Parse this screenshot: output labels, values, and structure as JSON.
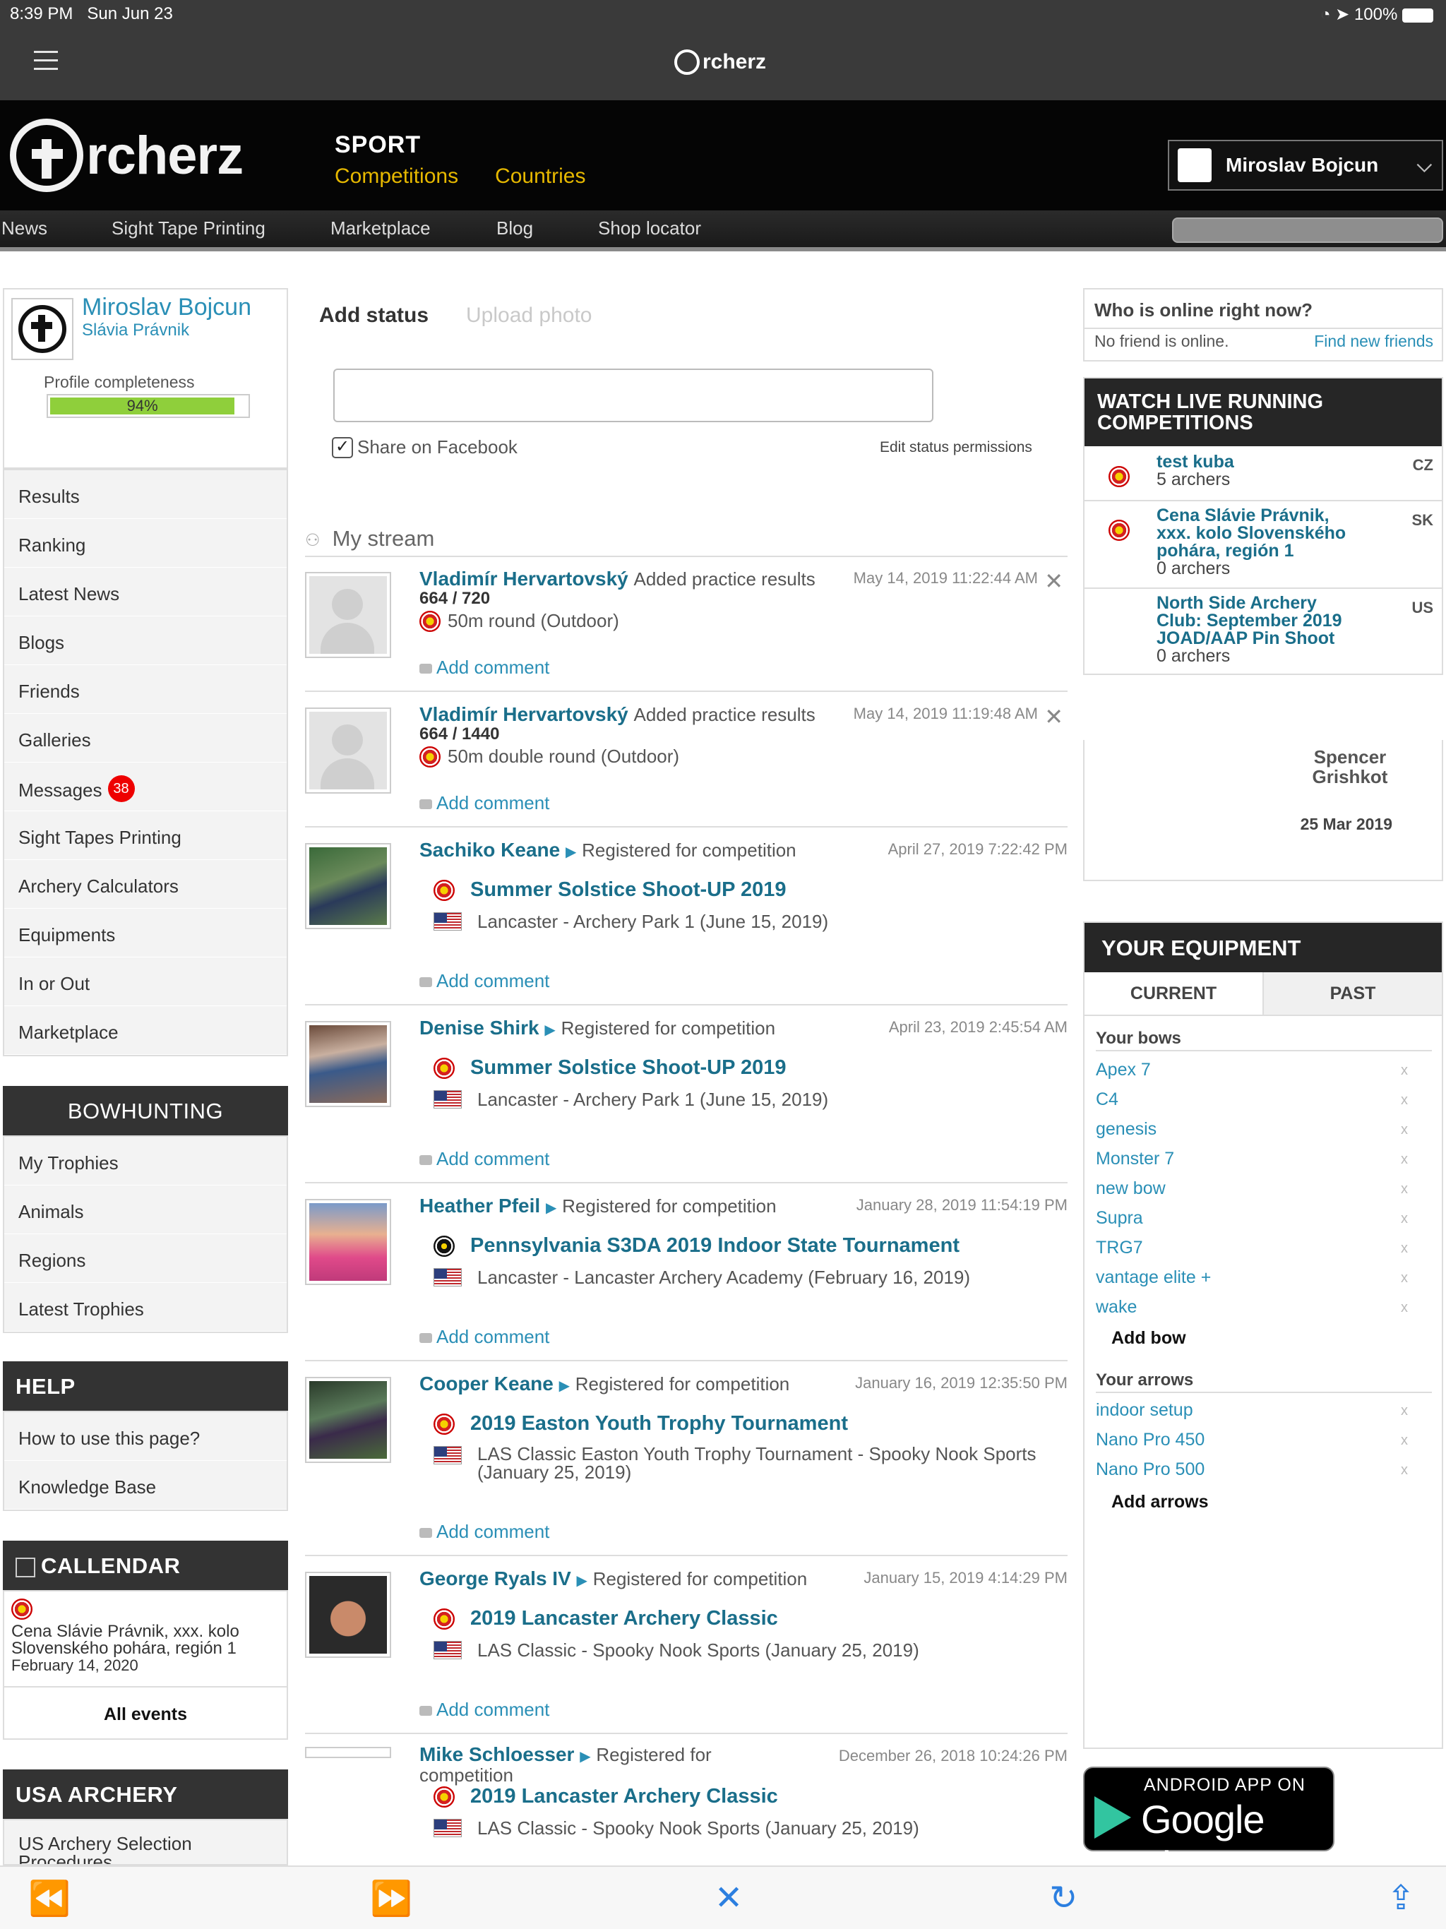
{
  "status_bar": {
    "time": "8:39 PM",
    "date": "Sun Jun 23",
    "battery": "100%"
  },
  "browser": {
    "logo_text": "rcherz"
  },
  "header": {
    "logo_text": "rcherz",
    "sport_title": "SPORT",
    "sport_links": [
      "Competitions",
      "Countries"
    ],
    "user_name": "Miroslav Bojcun"
  },
  "topnav": [
    "News",
    "Sight Tape Printing",
    "Marketplace",
    "Blog",
    "Shop locator"
  ],
  "profile": {
    "name": "Miroslav Bojcun",
    "club": "Slávia Právnik",
    "completeness_label": "Profile completeness",
    "completeness_value": "94%",
    "completeness_fraction": 0.94
  },
  "menu": {
    "items": [
      "Results",
      "Ranking",
      "Latest News",
      "Blogs",
      "Friends",
      "Galleries",
      "Messages",
      "Sight Tapes Printing",
      "Archery Calculators",
      "Equipments",
      "In or Out",
      "Marketplace"
    ],
    "messages_badge": "38"
  },
  "bowhunting": {
    "title": "BOWHUNTING",
    "items": [
      "My Trophies",
      "Animals",
      "Regions",
      "Latest Trophies"
    ]
  },
  "help": {
    "title": "HELP",
    "items": [
      "How to use this page?",
      "Knowledge Base"
    ]
  },
  "calendar": {
    "title": "CALLENDAR",
    "event_name": "Cena Slávie Právnik, xxx. kolo Slovenského pohára, región 1",
    "event_date": "February 14, 2020",
    "all_events": "All events"
  },
  "usa_archery": {
    "title": "USA ARCHERY",
    "item": "US Archery Selection Procedures"
  },
  "status": {
    "tab_active": "Add status",
    "tab_inactive": "Upload photo",
    "share_label": "Share on Facebook",
    "edit_permissions": "Edit status permissions"
  },
  "stream": {
    "title": "My stream",
    "add_comment": "Add comment",
    "items": [
      {
        "name": "Vladimír Hervartovský",
        "action": "Added practice results",
        "time": "May 14, 2019 11:22:44 AM",
        "score": "664 / 720",
        "round": "50m round (Outdoor)"
      },
      {
        "name": "Vladimír Hervartovský",
        "action": "Added practice results",
        "time": "May 14, 2019 11:19:48 AM",
        "score": "664 / 1440",
        "round": "50m double round (Outdoor)"
      },
      {
        "name": "Sachiko Keane",
        "action": "Registered for competition",
        "time": "April 27, 2019 7:22:42 PM",
        "competition": "Summer Solstice Shoot-UP 2019",
        "venue": "Lancaster - Archery Park 1 (June 15, 2019)"
      },
      {
        "name": "Denise Shirk",
        "action": "Registered for competition",
        "time": "April 23, 2019 2:45:54 AM",
        "competition": "Summer Solstice Shoot-UP 2019",
        "venue": "Lancaster - Archery Park 1 (June 15, 2019)"
      },
      {
        "name": "Heather Pfeil",
        "action": "Registered for competition",
        "time": "January 28, 2019 11:54:19 PM",
        "competition": "Pennsylvania S3DA 2019 Indoor State Tournament",
        "venue": "Lancaster - Lancaster Archery Academy (February 16, 2019)"
      },
      {
        "name": "Cooper Keane",
        "action": "Registered for competition",
        "time": "January 16, 2019 12:35:50 PM",
        "competition": "2019 Easton Youth Trophy Tournament",
        "venue": "LAS Classic Easton Youth Trophy Tournament - Spooky Nook Sports (January 25, 2019)"
      },
      {
        "name": "George Ryals IV",
        "action": "Registered for competition",
        "time": "January 15, 2019 4:14:29 PM",
        "competition": "2019 Lancaster Archery Classic",
        "venue": "LAS Classic - Spooky Nook Sports (January 25, 2019)"
      },
      {
        "name": "Mike Schloesser",
        "action": "Registered for competition",
        "time": "December 26, 2018 10:24:26 PM",
        "competition": "2019 Lancaster Archery Classic",
        "venue": "LAS Classic - Spooky Nook Sports (January 25, 2019)"
      }
    ]
  },
  "online": {
    "title": "Who is online right now?",
    "none": "No friend is online.",
    "find": "Find new friends"
  },
  "live": {
    "title": "WATCH LIVE RUNNING COMPETITIONS",
    "items": [
      {
        "name": "test kuba",
        "archers": "5 archers",
        "country": "CZ"
      },
      {
        "name": "Cena Slávie Právnik, xxx. kolo Slovenského pohára, región 1",
        "archers": "0 archers",
        "country": "SK"
      },
      {
        "name": "North Side Archery Club: September 2019 JOAD/AAP Pin Shoot",
        "archers": "0 archers",
        "country": "US"
      }
    ]
  },
  "spencer": {
    "name": "Spencer Grishkot",
    "date": "25 Mar 2019"
  },
  "equipment": {
    "title": "YOUR EQUIPMENT",
    "tabs": [
      "CURRENT",
      "PAST"
    ],
    "bows_title": "Your bows",
    "bows": [
      "Apex 7",
      "C4",
      "genesis",
      "Monster 7",
      "new bow",
      "Supra",
      "TRG7",
      "vantage elite +",
      "wake"
    ],
    "add_bow": "Add bow",
    "arrows_title": "Your arrows",
    "arrows": [
      "indoor setup",
      "Nano Pro 450",
      "Nano Pro 500"
    ],
    "add_arrows": "Add arrows",
    "remove_symbol": "x"
  },
  "google_play": {
    "line1": "ANDROID APP ON",
    "line2": "Google play"
  }
}
